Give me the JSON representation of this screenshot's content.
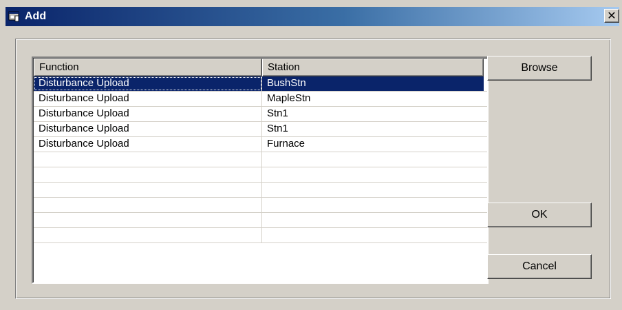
{
  "window": {
    "title": "Add",
    "close_label": "✕"
  },
  "table": {
    "headers": {
      "function": "Function",
      "station": "Station"
    },
    "rows": [
      {
        "function": "Disturbance Upload",
        "station": "BushStn",
        "selected": true
      },
      {
        "function": "Disturbance Upload",
        "station": "MapleStn",
        "selected": false
      },
      {
        "function": "Disturbance Upload",
        "station": "Stn1",
        "selected": false
      },
      {
        "function": "Disturbance Upload",
        "station": "Stn1",
        "selected": false
      },
      {
        "function": "Disturbance Upload",
        "station": "Furnace",
        "selected": false
      },
      {
        "function": "",
        "station": "",
        "selected": false
      },
      {
        "function": "",
        "station": "",
        "selected": false
      },
      {
        "function": "",
        "station": "",
        "selected": false
      },
      {
        "function": "",
        "station": "",
        "selected": false
      },
      {
        "function": "",
        "station": "",
        "selected": false
      },
      {
        "function": "",
        "station": "",
        "selected": false
      }
    ]
  },
  "buttons": {
    "browse": "Browse",
    "ok": "OK",
    "cancel": "Cancel"
  },
  "colors": {
    "titlebar_start": "#0a246a",
    "titlebar_end": "#a6caf0",
    "dialog_face": "#d4d0c8",
    "selection": "#0a246a"
  },
  "icons": {
    "title_icon": "app-window-icon",
    "close": "close-icon"
  }
}
